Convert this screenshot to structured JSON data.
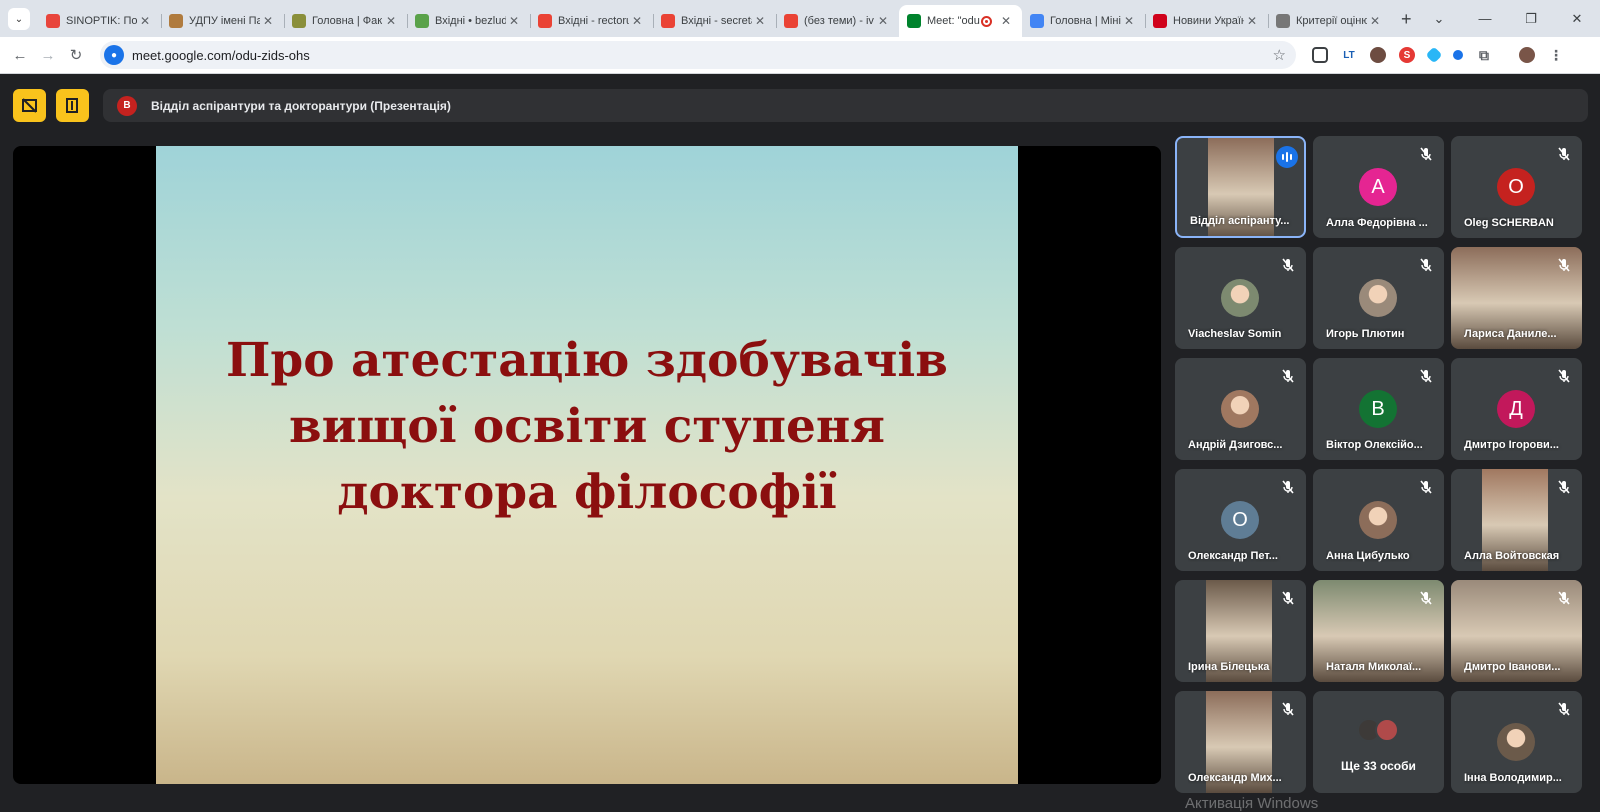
{
  "browser": {
    "tabs": [
      {
        "title": "SINOPTIK: Пог",
        "favicon": "thermometer-icon",
        "color": "#e8453c"
      },
      {
        "title": "УДПУ імені Па",
        "favicon": "university-logo",
        "color": "#b07b3e"
      },
      {
        "title": "Головна | Фак",
        "favicon": "faculty-logo",
        "color": "#8a8f3a"
      },
      {
        "title": "Вхідні • bezlud",
        "favicon": "mail-icon",
        "color": "#5aa24a"
      },
      {
        "title": "Вхідні - rectoru",
        "favicon": "gmail-icon",
        "color": "#ea4335"
      },
      {
        "title": "Вхідні - secreta",
        "favicon": "gmail-icon",
        "color": "#ea4335"
      },
      {
        "title": "(без теми) - iv",
        "favicon": "gmail-icon",
        "color": "#ea4335"
      },
      {
        "title": "Meet: \"odu",
        "favicon": "meet-icon",
        "color": "#00832d",
        "active": true,
        "recording": true
      },
      {
        "title": "Головна | Міні",
        "favicon": "ministry-logo",
        "color": "#4285f4"
      },
      {
        "title": "Новини Україн",
        "favicon": "tsn-logo",
        "color": "#d0021b"
      },
      {
        "title": "Критерії оціню",
        "favicon": "globe-icon",
        "color": "#777777"
      }
    ],
    "url": "meet.google.com/odu-zids-ohs"
  },
  "meet": {
    "presenter_initial": "В",
    "presentation_title": "Відділ аспірантури та докторантури (Презентація)",
    "slide": {
      "lines": [
        "Про атестацію здобувачів",
        "вищої освіти ступеня",
        "доктора філософії"
      ]
    },
    "participants": [
      {
        "name": "Відділ аспіранту...",
        "type": "video",
        "speaking": true
      },
      {
        "name": "Алла Федорівна ...",
        "initial": "А",
        "color": "#e52592"
      },
      {
        "name": "Oleg SCHERBAN",
        "initial": "O",
        "color": "#c5221f"
      },
      {
        "name": "Viacheslav Somin",
        "type": "photo"
      },
      {
        "name": "Игорь Плютин",
        "type": "photo"
      },
      {
        "name": "Лариса Даниле...",
        "type": "video"
      },
      {
        "name": "Андрій Дзиговс...",
        "type": "photo"
      },
      {
        "name": "Віктор Олексійо...",
        "initial": "В",
        "color": "#137333"
      },
      {
        "name": "Дмитро Ігорови...",
        "initial": "Д",
        "color": "#c2185b"
      },
      {
        "name": "Олександр Пет...",
        "initial": "О",
        "color": "#5f7d95"
      },
      {
        "name": "Анна Цибулько",
        "type": "photo"
      },
      {
        "name": "Алла Войтовская",
        "type": "video"
      },
      {
        "name": "Ірина Білецька",
        "type": "video"
      },
      {
        "name": "Наталя Миколаї...",
        "type": "video"
      },
      {
        "name": "Дмитро Іванови...",
        "type": "video"
      },
      {
        "name": "Олександр Мих...",
        "type": "video"
      },
      {
        "name": "Ще 33 особи",
        "type": "more"
      },
      {
        "name": "Інна Володимир...",
        "type": "photo"
      }
    ]
  },
  "watermark": "Активація Windows"
}
